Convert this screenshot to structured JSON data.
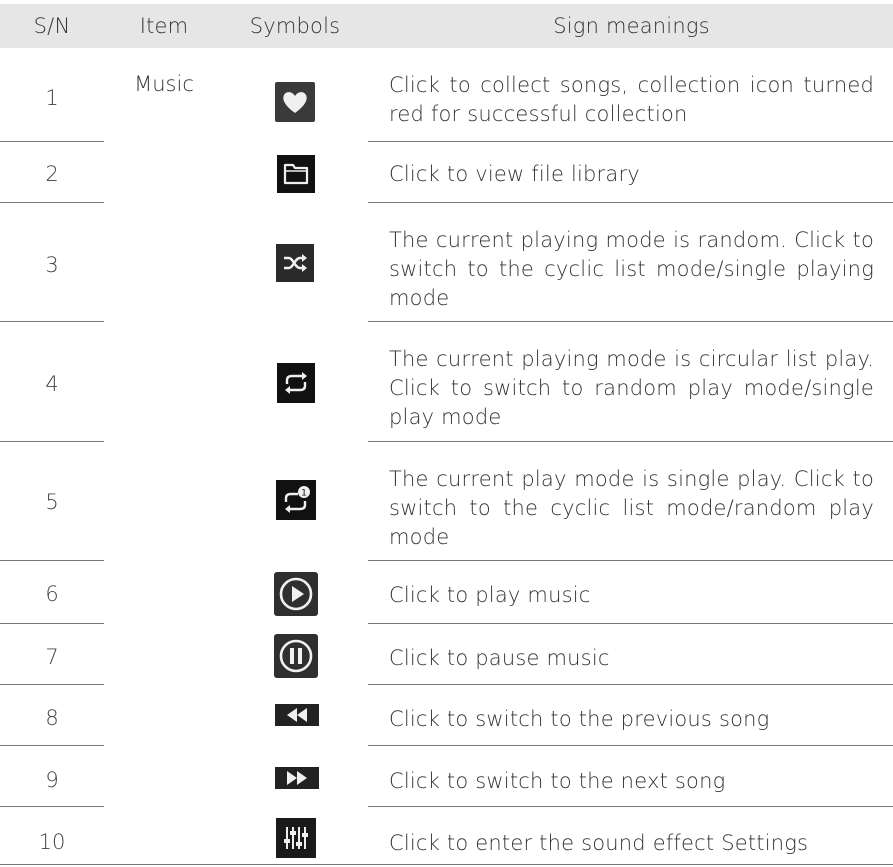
{
  "headers": {
    "sn": "S/N",
    "item": "Item",
    "symbols": "Symbols",
    "meanings": "Sign meanings"
  },
  "item_group": "Music",
  "rows": [
    {
      "sn": "1",
      "icon": "heart-icon",
      "meaning": "Click to collect songs, collection icon turned red for successful collection"
    },
    {
      "sn": "2",
      "icon": "folder-icon",
      "meaning": "Click to view file library"
    },
    {
      "sn": "3",
      "icon": "shuffle-icon",
      "meaning": "The current playing mode is random. Click to switch to the cyclic list mode/single playing mode"
    },
    {
      "sn": "4",
      "icon": "repeat-icon",
      "meaning": "The current playing mode is circular list play. Click to switch to random play mode/single play mode"
    },
    {
      "sn": "5",
      "icon": "repeat-one-icon",
      "meaning": "The current play mode is single play. Click to switch to the cyclic list mode/random play mode"
    },
    {
      "sn": "6",
      "icon": "play-icon",
      "meaning": "Click to play music"
    },
    {
      "sn": "7",
      "icon": "pause-icon",
      "meaning": "Click to pause music"
    },
    {
      "sn": "8",
      "icon": "rewind-icon",
      "meaning": "Click to switch to the previous song"
    },
    {
      "sn": "9",
      "icon": "fast-forward-icon",
      "meaning": "Click to switch to the next song"
    },
    {
      "sn": "10",
      "icon": "equalizer-icon",
      "meaning": "Click to enter the sound effect Settings"
    }
  ]
}
